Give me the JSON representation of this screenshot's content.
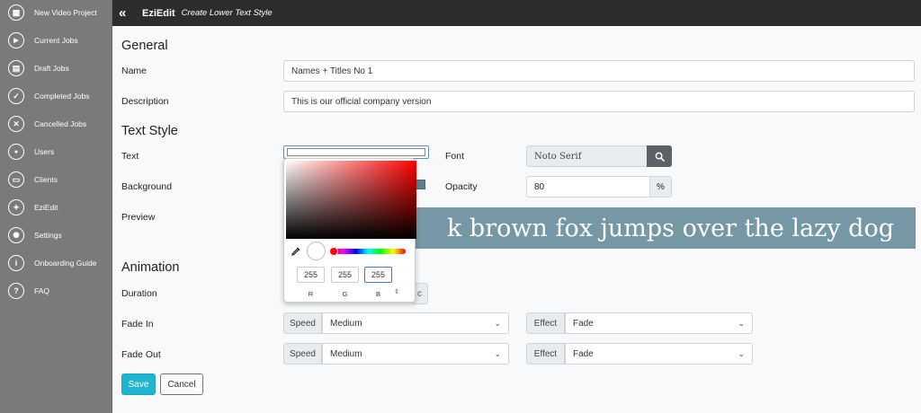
{
  "sidebar": {
    "items": [
      {
        "label": "New Video Project",
        "icon": "grid-icon",
        "glyph": "▦"
      },
      {
        "label": "Current Jobs",
        "icon": "video-icon",
        "glyph": "▶"
      },
      {
        "label": "Draft Jobs",
        "icon": "file-icon",
        "glyph": "▤"
      },
      {
        "label": "Completed Jobs",
        "icon": "check-icon",
        "glyph": "✓"
      },
      {
        "label": "Cancelled Jobs",
        "icon": "thumbs-down-icon",
        "glyph": "✕"
      },
      {
        "label": "Users",
        "icon": "user-icon",
        "glyph": "●"
      },
      {
        "label": "Clients",
        "icon": "briefcase-icon",
        "glyph": "▭"
      },
      {
        "label": "EziEdit",
        "icon": "magic-wand-icon",
        "glyph": "✦"
      },
      {
        "label": "Settings",
        "icon": "gear-icon",
        "glyph": "✺"
      },
      {
        "label": "Onboarding Guide",
        "icon": "info-icon",
        "glyph": "i"
      },
      {
        "label": "FAQ",
        "icon": "question-icon",
        "glyph": "?"
      }
    ]
  },
  "topbar": {
    "collapse": "«",
    "brand": "EziEdit",
    "subtitle": "Create Lower Text Style"
  },
  "general": {
    "heading": "General",
    "name_label": "Name",
    "name_value": "Names + Titles No 1",
    "description_label": "Description",
    "description_value": "This is our official company version"
  },
  "text_style": {
    "heading": "Text Style",
    "text_label": "Text",
    "text_color": "#ffffff",
    "background_label": "Background",
    "background_color": "#5a7f8e",
    "preview_label": "Preview",
    "font_label": "Font",
    "font_value": "Noto Serif",
    "opacity_label": "Opacity",
    "opacity_value": "80",
    "opacity_unit": "%",
    "preview_text": "k brown fox jumps over the lazy dog",
    "preview_bg": "#7697a5"
  },
  "color_picker": {
    "r": "255",
    "g": "255",
    "b": "255",
    "r_label": "R",
    "g_label": "G",
    "b_label": "B",
    "toggle": "⇕",
    "hue_color": "#ff0000"
  },
  "animation": {
    "heading": "Animation",
    "duration_label": "Duration",
    "duration_unit_tail": "c",
    "fade_in_label": "Fade In",
    "fade_out_label": "Fade Out",
    "speed_addon": "Speed",
    "effect_addon": "Effect",
    "fade_in_speed": "Medium",
    "fade_in_effect": "Fade",
    "fade_out_speed": "Medium",
    "fade_out_effect": "Fade"
  },
  "actions": {
    "save": "Save",
    "cancel": "Cancel"
  }
}
